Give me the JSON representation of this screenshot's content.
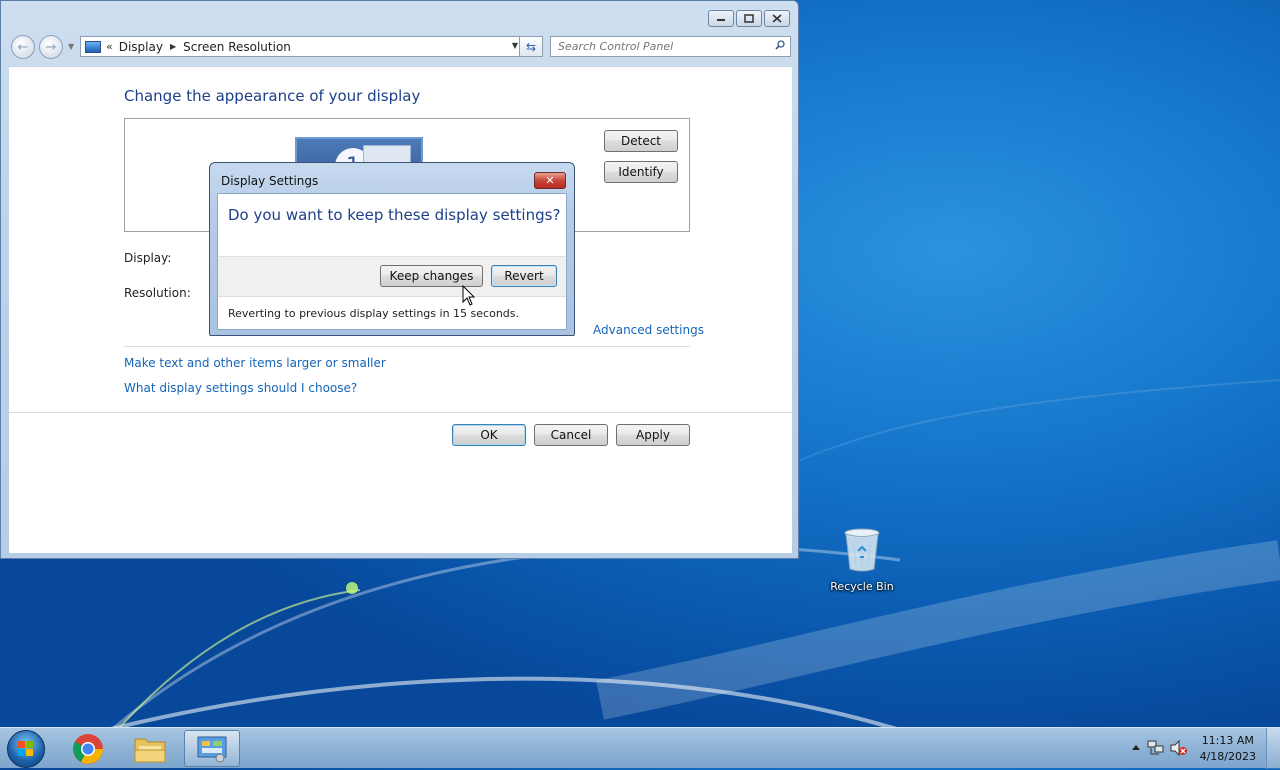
{
  "window": {
    "breadcrumb": [
      "Display",
      "Screen Resolution"
    ],
    "breadcrumb_prefix": "«",
    "search_placeholder": "Search Control Panel",
    "caption_buttons": {
      "minimize": "▭",
      "maximize": "◻",
      "close": "✕"
    }
  },
  "screen_resolution": {
    "heading": "Change the appearance of your display",
    "monitor_number": "1",
    "detect_label": "Detect",
    "identify_label": "Identify",
    "display_label": "Display:",
    "resolution_label": "Resolution:",
    "advanced_link": "Advanced settings",
    "links": [
      "Make text and other items larger or smaller",
      "What display settings should I choose?"
    ],
    "ok_label": "OK",
    "cancel_label": "Cancel",
    "apply_label": "Apply"
  },
  "dialog": {
    "title": "Display Settings",
    "close_glyph": "✕",
    "question": "Do you want to keep these display settings?",
    "keep_label": "Keep changes",
    "revert_label": "Revert",
    "status": "Reverting to previous display settings in 15 seconds."
  },
  "desktop": {
    "recycle_bin_label": "Recycle Bin"
  },
  "taskbar": {
    "time": "11:13 AM",
    "date": "4/18/2023",
    "apps": [
      "chrome",
      "file-explorer",
      "control-panel"
    ]
  },
  "colors": {
    "accent_blue": "#1e3f8a",
    "link_blue": "#1565b8",
    "desktop_blue": "#1677cc"
  }
}
